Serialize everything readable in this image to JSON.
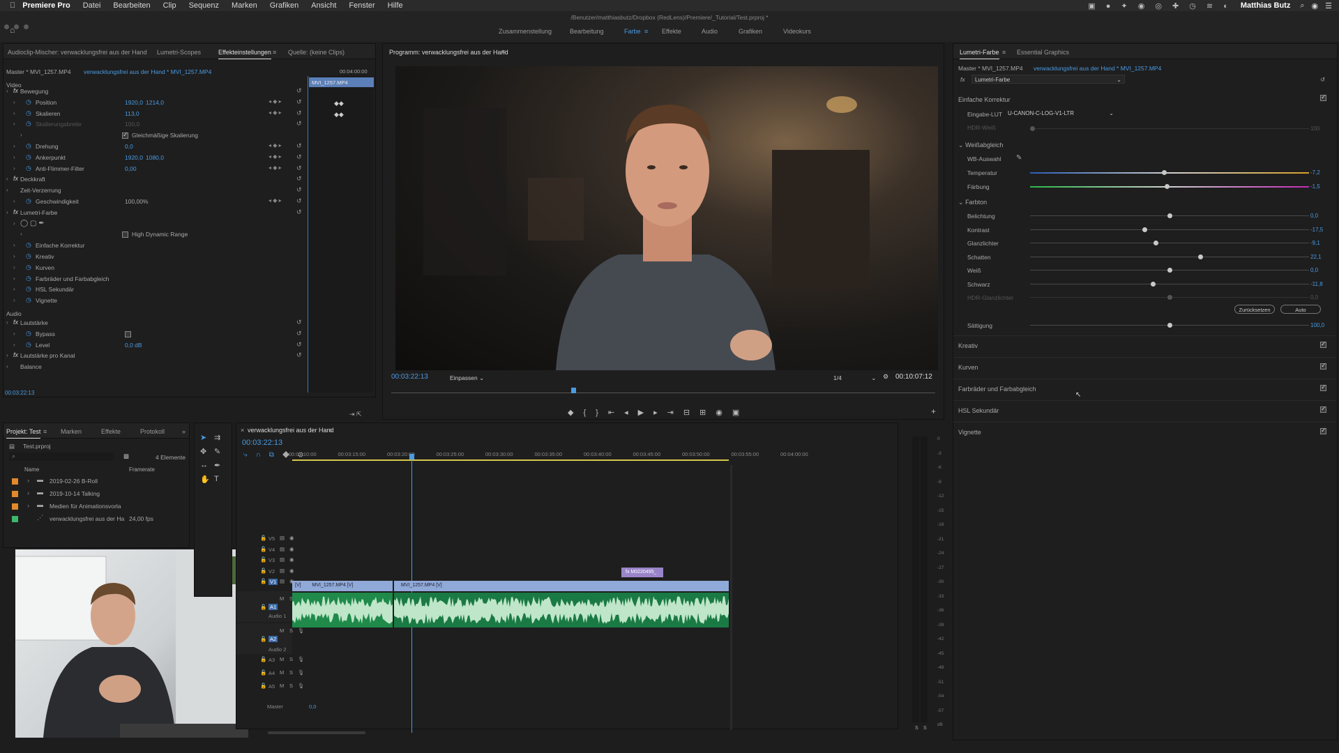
{
  "menubar": {
    "app": "Premiere Pro",
    "items": [
      "Datei",
      "Bearbeiten",
      "Clip",
      "Sequenz",
      "Marken",
      "Grafiken",
      "Ansicht",
      "Fenster",
      "Hilfe"
    ],
    "user": "Matthias Butz"
  },
  "title": "/Benutzer/matthiasbutz/Dropbox (RedLens)/Premiere/_Tutorial/Test.prproj *",
  "workspaces": [
    "Zusammenstellung",
    "Bearbeitung",
    "Farbe",
    "Effekte",
    "Audio",
    "Grafiken",
    "Videokurs"
  ],
  "active_workspace": "Farbe",
  "effects_panel": {
    "tabs": [
      "Audioclip-Mischer: verwacklungsfrei aus der Hand",
      "Lumetri-Scopes",
      "Effekteinstellungen",
      "Quelle: (keine Clips)"
    ],
    "master_label": "Master * MVI_1257.MP4",
    "clip_label": "verwacklungsfrei aus der Hand * MVI_1257.MP4",
    "timecode_head": "00:04:00:00",
    "clip_block": "MVI_1257.MP4",
    "video_label": "Video",
    "rows": [
      {
        "name": "Bewegung",
        "indent": 1,
        "fx": true
      },
      {
        "name": "Position",
        "indent": 2,
        "v1": "1920,0",
        "v2": "1214,0"
      },
      {
        "name": "Skalieren",
        "indent": 2,
        "v1": "113,0"
      },
      {
        "name": "Skalierungsbreite",
        "indent": 2,
        "v1": "100,0",
        "dim": true
      },
      {
        "name": "Gleichmäßige Skalierung",
        "indent": 3,
        "check": true
      },
      {
        "name": "Drehung",
        "indent": 2,
        "v1": "0,0"
      },
      {
        "name": "Ankerpunkt",
        "indent": 2,
        "v1": "1920,0",
        "v2": "1080,0"
      },
      {
        "name": "Anti-Flimmer-Filter",
        "indent": 2,
        "v1": "0,00"
      },
      {
        "name": "Deckkraft",
        "indent": 1,
        "fx": true
      },
      {
        "name": "Zeit-Verzerrung",
        "indent": 1
      },
      {
        "name": "Geschwindigkeit",
        "indent": 2,
        "v1": "100,00%",
        "gray": true
      },
      {
        "name": "Lumetri-Farbe",
        "indent": 1,
        "fx": true
      },
      {
        "name": "",
        "indent": 2
      },
      {
        "name": "High Dynamic Range",
        "indent": 3,
        "check": false
      },
      {
        "name": "Einfache Korrektur",
        "indent": 2
      },
      {
        "name": "Kreativ",
        "indent": 2
      },
      {
        "name": "Kurven",
        "indent": 2
      },
      {
        "name": "Farbräder und Farbabgleich",
        "indent": 2
      },
      {
        "name": "HSL Sekundär",
        "indent": 2
      },
      {
        "name": "Vignette",
        "indent": 2
      }
    ],
    "audio_label": "Audio",
    "audio_rows": [
      {
        "name": "Lautstärke",
        "indent": 1,
        "fx": true
      },
      {
        "name": "Bypass",
        "indent": 2
      },
      {
        "name": "Level",
        "indent": 2,
        "v1": "0,0 dB"
      },
      {
        "name": "Lautstärke pro Kanal",
        "indent": 1,
        "fx": true
      },
      {
        "name": "Balance",
        "indent": 1
      }
    ],
    "timecode_bottom": "00:03:22:13"
  },
  "program_monitor": {
    "title": "Programm: verwacklungsfrei aus der Hand",
    "timecode": "00:03:22:13",
    "fit": "Einpassen",
    "resolution": "1/4",
    "duration": "00:10:07:12"
  },
  "project_panel": {
    "tabs": [
      "Projekt: Test",
      "Marken",
      "Effekte",
      "Protokoll"
    ],
    "file": "Test.prproj",
    "count": "4 Elemente",
    "col_name": "Name",
    "col_rate": "Framerate",
    "items": [
      {
        "name": "2019-02-26 B-Roll",
        "color": "#e08a2a",
        "type": "folder"
      },
      {
        "name": "2019-10-14 Talking",
        "color": "#e08a2a",
        "type": "folder"
      },
      {
        "name": "Medien für Animationsvorla",
        "color": "#e08a2a",
        "type": "folder"
      },
      {
        "name": "verwacklungsfrei aus der Ha",
        "rate": "24,00 fps",
        "color": "#3bb86a",
        "type": "seq"
      }
    ]
  },
  "timeline": {
    "title": "verwacklungsfrei aus der Hand",
    "timecode": "00:03:22:13",
    "ruler": [
      "00:03:10:00",
      "00:03:15:00",
      "00:03:20:00",
      "00:03:25:00",
      "00:03:30:00",
      "00:03:35:00",
      "00:03:40:00",
      "00:03:45:00",
      "00:03:50:00",
      "00:03:55:00",
      "00:04:00:00"
    ],
    "video_tracks": [
      "V5",
      "V4",
      "V3",
      "V2",
      "V1"
    ],
    "audio_tracks": [
      "A1",
      "A2",
      "A3",
      "A4",
      "A5"
    ],
    "audio1": "Audio 1",
    "audio2": "Audio 2",
    "master": "Master",
    "master_val": "0,0",
    "clip1": "MVI_1257.MP4 [V]",
    "clip2": "MVI_1257.MP4 [V]",
    "clip_v2": "M0220495_",
    "fx_tag": "[V]"
  },
  "meter_scale": [
    "0",
    "-3",
    "-6",
    "-9",
    "-12",
    "-15",
    "-18",
    "-21",
    "-24",
    "-27",
    "-30",
    "-33",
    "-36",
    "-39",
    "-42",
    "-45",
    "-48",
    "-51",
    "-54",
    "-57",
    "dB"
  ],
  "meter_bottom": [
    "S",
    "S"
  ],
  "lumetri": {
    "tabs": [
      "Lumetri-Farbe",
      "Essential Graphics"
    ],
    "master_label": "Master * MVI_1257.MP4",
    "clip_label": "verwacklungsfrei aus der Hand * MVI_1257.MP4",
    "effect": "Lumetri-Farbe",
    "basic": "Einfache Korrektur",
    "lut_label": "Eingabe-LUT",
    "lut_value": "U-CANON-C-LOG-V1-LTR",
    "hdr_white": "HDR-Weiß",
    "hdr_white_val": "100",
    "wb": "Weißabgleich",
    "wb_pick": "WB-Auswahl",
    "tone": "Farbton",
    "sliders_wb": [
      {
        "label": "Temperatur",
        "value": "-7,2",
        "pos": 0.48,
        "track": "temp"
      },
      {
        "label": "Färbung",
        "value": "-1,5",
        "pos": 0.49,
        "track": "tint"
      }
    ],
    "sliders_tone": [
      {
        "label": "Belichtung",
        "value": "0,0",
        "pos": 0.5
      },
      {
        "label": "Kontrast",
        "value": "-17,5",
        "pos": 0.41
      },
      {
        "label": "Glanzlichter",
        "value": "-9,1",
        "pos": 0.45
      },
      {
        "label": "Schatten",
        "value": "22,1",
        "pos": 0.61
      },
      {
        "label": "Weiß",
        "value": "0,0",
        "pos": 0.5
      },
      {
        "label": "Schwarz",
        "value": "-11,8",
        "pos": 0.44
      },
      {
        "label": "HDR-Glanzlichter",
        "value": "0,0",
        "pos": 0.5,
        "dim": true
      }
    ],
    "reset": "Zurücksetzen",
    "auto": "Auto",
    "saturation": {
      "label": "Sättigung",
      "value": "100,0",
      "pos": 0.5
    },
    "sections": [
      "Kreativ",
      "Kurven",
      "Farbräder und Farbabgleich",
      "HSL Sekundär",
      "Vignette"
    ]
  }
}
